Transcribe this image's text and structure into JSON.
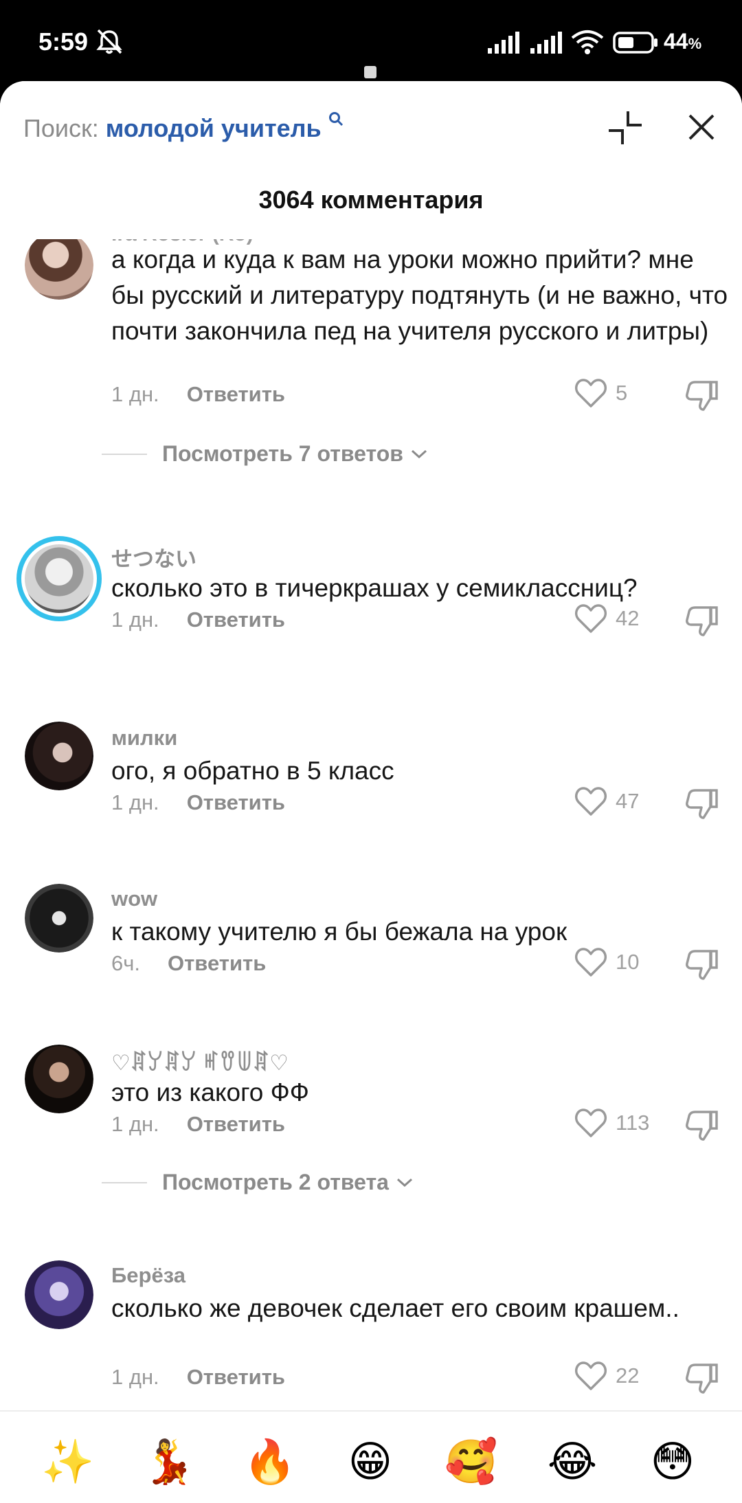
{
  "status": {
    "time": "5:59",
    "battery": "44",
    "battery_unit": "%"
  },
  "header": {
    "search_label": "Поиск: ",
    "search_query": "молодой учитель",
    "comments_title": "3064 комментария"
  },
  "cropped_username": "Ira Rosler (Ro)",
  "comments": [
    {
      "text": "а когда и куда к вам на уроки можно прийти? мне бы русский и литературу подтянуть (и не важно, что почти закончила пед на учителя русского и литры)",
      "time": "1 дн.",
      "reply_label": "Ответить",
      "likes": "5",
      "view_replies": "Посмотреть 7 ответов"
    },
    {
      "username": "せつない",
      "text": "сколько это в тичеркрашах у семиклассниц?",
      "time": "1 дн.",
      "reply_label": "Ответить",
      "likes": "42"
    },
    {
      "username": "милки",
      "text": "ого, я обратно в 5 класс",
      "time": "1 дн.",
      "reply_label": "Ответить",
      "likes": "47"
    },
    {
      "username": "wow",
      "text": "к такому учителю я бы бежала на урок",
      "time": "6ч.",
      "reply_label": "Ответить",
      "likes": "10"
    },
    {
      "username": "♡ꁲꌦꁲꌦ ꎭꀎꅐꁲ♡",
      "text": "это из какого ФФ",
      "time": "1 дн.",
      "reply_label": "Ответить",
      "likes": "113",
      "view_replies": "Посмотреть 2 ответа"
    },
    {
      "username": "Берёза",
      "text": "сколько же девочек сделает его своим крашем..",
      "time": "1 дн.",
      "reply_label": "Ответить",
      "likes": "22"
    }
  ],
  "emojis": [
    "✨",
    "💃",
    "🔥",
    "😁",
    "🥰",
    "😂",
    "😳"
  ],
  "colors": {
    "accent_query": "#2b5caa",
    "story_ring": "#34c1ec",
    "muted_text": "#8e8e8e"
  }
}
